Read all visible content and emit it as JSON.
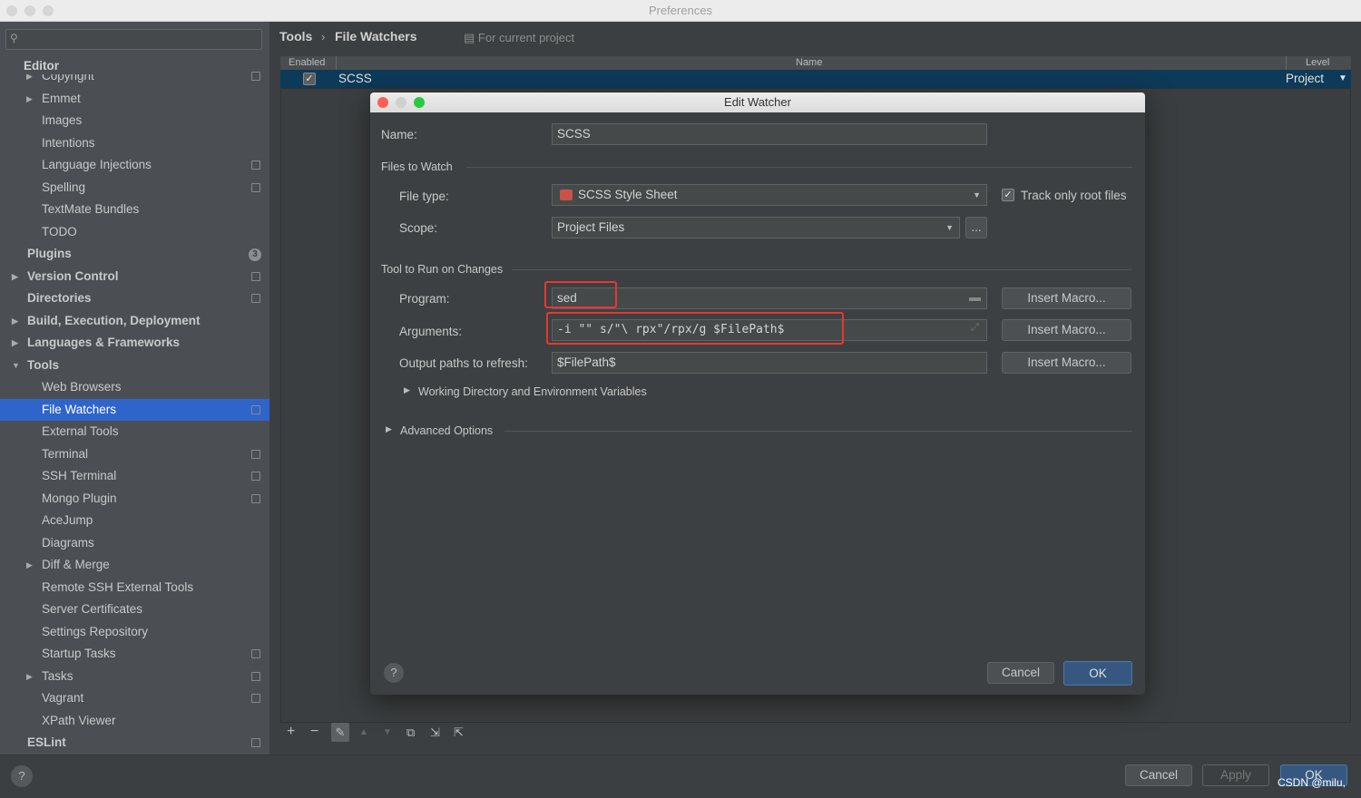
{
  "window": {
    "title": "Preferences"
  },
  "sidebar": {
    "search_placeholder": "",
    "header": "Editor",
    "items": [
      {
        "label": "Copyright",
        "level": 1,
        "arrow": "right",
        "icon": "project-scope-icon"
      },
      {
        "label": "Emmet",
        "level": 1,
        "arrow": "right"
      },
      {
        "label": "Images",
        "level": 1
      },
      {
        "label": "Intentions",
        "level": 1
      },
      {
        "label": "Language Injections",
        "level": 1,
        "icon": "project-scope-icon"
      },
      {
        "label": "Spelling",
        "level": 1,
        "icon": "project-scope-icon"
      },
      {
        "label": "TextMate Bundles",
        "level": 1
      },
      {
        "label": "TODO",
        "level": 1
      },
      {
        "label": "Plugins",
        "level": 0,
        "badge": "3"
      },
      {
        "label": "Version Control",
        "level": 0,
        "arrow": "right",
        "icon": "project-scope-icon"
      },
      {
        "label": "Directories",
        "level": 0,
        "icon": "project-scope-icon"
      },
      {
        "label": "Build, Execution, Deployment",
        "level": 0,
        "arrow": "right"
      },
      {
        "label": "Languages & Frameworks",
        "level": 0,
        "arrow": "right"
      },
      {
        "label": "Tools",
        "level": 0,
        "arrow": "down"
      },
      {
        "label": "Web Browsers",
        "level": 1
      },
      {
        "label": "File Watchers",
        "level": 1,
        "icon": "project-scope-icon",
        "selected": true
      },
      {
        "label": "External Tools",
        "level": 1
      },
      {
        "label": "Terminal",
        "level": 1,
        "icon": "project-scope-icon"
      },
      {
        "label": "SSH Terminal",
        "level": 1,
        "icon": "project-scope-icon"
      },
      {
        "label": "Mongo Plugin",
        "level": 1,
        "icon": "project-scope-icon"
      },
      {
        "label": "AceJump",
        "level": 1
      },
      {
        "label": "Diagrams",
        "level": 1
      },
      {
        "label": "Diff & Merge",
        "level": 1,
        "arrow": "right"
      },
      {
        "label": "Remote SSH External Tools",
        "level": 1
      },
      {
        "label": "Server Certificates",
        "level": 1
      },
      {
        "label": "Settings Repository",
        "level": 1
      },
      {
        "label": "Startup Tasks",
        "level": 1,
        "icon": "project-scope-icon"
      },
      {
        "label": "Tasks",
        "level": 1,
        "arrow": "right",
        "icon": "project-scope-icon"
      },
      {
        "label": "Vagrant",
        "level": 1,
        "icon": "project-scope-icon"
      },
      {
        "label": "XPath Viewer",
        "level": 1
      },
      {
        "label": "ESLint",
        "level": 0,
        "icon": "project-scope-icon"
      }
    ]
  },
  "breadcrumb": {
    "parent": "Tools",
    "separator": "›",
    "current": "File Watchers",
    "scope": "For current project"
  },
  "table": {
    "headers": [
      "Enabled",
      "Name",
      "Level"
    ],
    "rows": [
      {
        "enabled": true,
        "name": "SCSS",
        "level": "Project"
      }
    ]
  },
  "dialog": {
    "title": "Edit Watcher",
    "name_label": "Name:",
    "name_value": "SCSS",
    "files_section": "Files to Watch",
    "file_type_label": "File type:",
    "file_type_value": "SCSS Style Sheet",
    "track_root_label": "Track only root files",
    "track_root_checked": true,
    "scope_label": "Scope:",
    "scope_value": "Project Files",
    "scope_more": "...",
    "tool_section": "Tool to Run on Changes",
    "program_label": "Program:",
    "program_value": "sed",
    "arguments_label": "Arguments:",
    "arguments_value": "-i \"\" s/\"\\ rpx\"/rpx/g $FilePath$",
    "output_label": "Output paths to refresh:",
    "output_value": "$FilePath$",
    "insert_macro": "Insert Macro...",
    "working_dir": "Working Directory and Environment Variables",
    "advanced": "Advanced Options",
    "help": "?",
    "cancel": "Cancel",
    "ok": "OK"
  },
  "footer": {
    "help": "?",
    "cancel": "Cancel",
    "apply": "Apply",
    "ok": "OK",
    "watermark": "CSDN @milu,"
  },
  "colors": {
    "selection": "#2f65ca",
    "row_selected": "#0d3a58",
    "highlight": "#e8372f",
    "primary_button": "#365880"
  }
}
